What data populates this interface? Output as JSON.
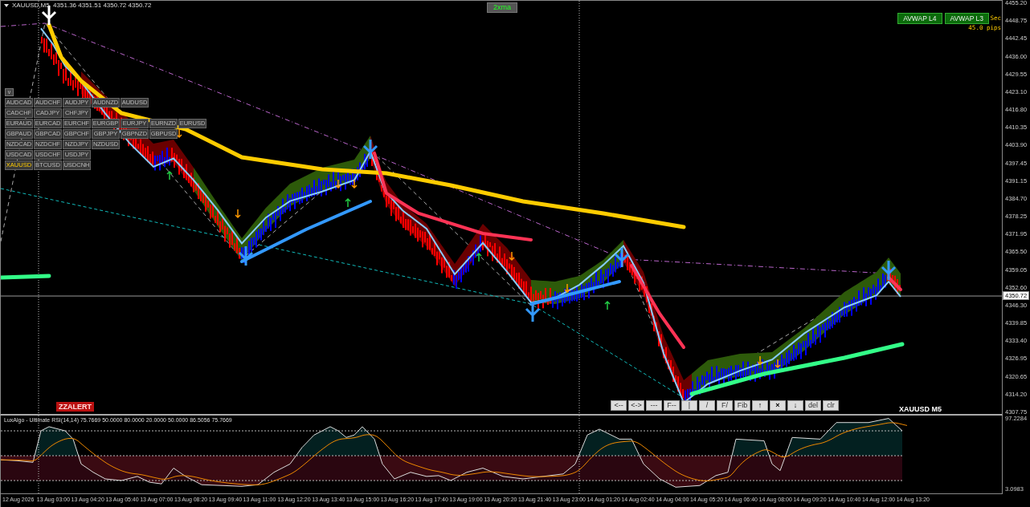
{
  "chart": {
    "header": "XAUUSD,M5  4351.36 4351.51 4350.72 4350.72",
    "caption": "XAUUSD M5",
    "current_price": "4350.72",
    "price_ticks": [
      "4455.20",
      "4448.75",
      "4442.45",
      "4436.00",
      "4429.55",
      "4423.10",
      "4416.80",
      "4410.35",
      "4403.90",
      "4397.45",
      "4391.15",
      "4384.70",
      "4378.25",
      "4371.95",
      "4365.50",
      "4359.05",
      "4352.60",
      "4346.30",
      "4339.85",
      "4333.40",
      "4326.95",
      "4320.65",
      "4314.20",
      "4307.75"
    ]
  },
  "indicator_button": "2xma",
  "avwap_buttons": [
    "AVWAP L4",
    "AVWAP L3"
  ],
  "countdown": {
    "unit": "Sec",
    "pips": "45.0 pips"
  },
  "alert_label": "ZZALERT",
  "symbol_panel": {
    "toggle": "v",
    "rows": [
      [
        {
          "label": "AUDCAD",
          "selected": false
        },
        {
          "label": "AUDCHF",
          "selected": false
        },
        {
          "label": "AUDJPY",
          "selected": false
        },
        {
          "label": "AUDNZD",
          "selected": false
        },
        {
          "label": "AUDUSD",
          "selected": false
        }
      ],
      [
        {
          "label": "CADCHF",
          "selected": false
        },
        {
          "label": "CADJPY",
          "selected": false
        },
        {
          "label": "CHFJPY",
          "selected": false
        }
      ],
      [
        {
          "label": "EURAUD",
          "selected": false
        },
        {
          "label": "EURCAD",
          "selected": false
        },
        {
          "label": "EURCHF",
          "selected": false
        },
        {
          "label": "EURGBP",
          "selected": false
        },
        {
          "label": "EURJPY",
          "selected": false
        },
        {
          "label": "EURNZD",
          "selected": false
        },
        {
          "label": "EURUSD",
          "selected": false
        }
      ],
      [
        {
          "label": "GBPAUD",
          "selected": false
        },
        {
          "label": "GBPCAD",
          "selected": false
        },
        {
          "label": "GBPCHF",
          "selected": false
        },
        {
          "label": "GBPJPY",
          "selected": false
        },
        {
          "label": "GBPNZD",
          "selected": false
        },
        {
          "label": "GBPUSD",
          "selected": false
        }
      ],
      [
        {
          "label": "NZDCAD",
          "selected": false
        },
        {
          "label": "NZDCHF",
          "selected": false
        },
        {
          "label": "NZDJPY",
          "selected": false
        },
        {
          "label": "NZDUSD",
          "selected": false
        }
      ],
      [
        {
          "label": "USDCAD",
          "selected": false
        },
        {
          "label": "USDCHF",
          "selected": false
        },
        {
          "label": "USDJPY",
          "selected": false
        }
      ],
      [
        {
          "label": "XAUUSD",
          "selected": true
        },
        {
          "label": "BTCUSD",
          "selected": false
        },
        {
          "label": "USDCNH",
          "selected": false
        }
      ]
    ]
  },
  "drawing_tools": [
    "<--",
    "<->",
    "---",
    "F--",
    "|",
    "/",
    "F/",
    "Fib",
    "↑",
    "×",
    "↓",
    "del",
    "clr"
  ],
  "rsi_panel": {
    "title": "LuxAlgo - Ultimate RSI(14,14) 75.7669 50.0000 80.0000 20.0000 50.0000 86.5056 75.7669",
    "ticks": [
      "97.2284",
      "3.0983"
    ]
  },
  "time_axis": [
    "12 Aug 2026",
    "13 Aug 03:00",
    "13 Aug 04:20",
    "13 Aug 05:40",
    "13 Aug 07:00",
    "13 Aug 08:20",
    "13 Aug 09:40",
    "13 Aug 11:00",
    "13 Aug 12:20",
    "13 Aug 13:40",
    "13 Aug 15:00",
    "13 Aug 16:20",
    "13 Aug 17:40",
    "13 Aug 19:00",
    "13 Aug 20:20",
    "13 Aug 21:40",
    "13 Aug 23:00",
    "14 Aug 01:20",
    "14 Aug 02:40",
    "14 Aug 04:00",
    "14 Aug 05:20",
    "14 Aug 06:40",
    "14 Aug 08:00",
    "14 Aug 09:20",
    "14 Aug 10:40",
    "14 Aug 12:00",
    "14 Aug 13:20"
  ]
}
